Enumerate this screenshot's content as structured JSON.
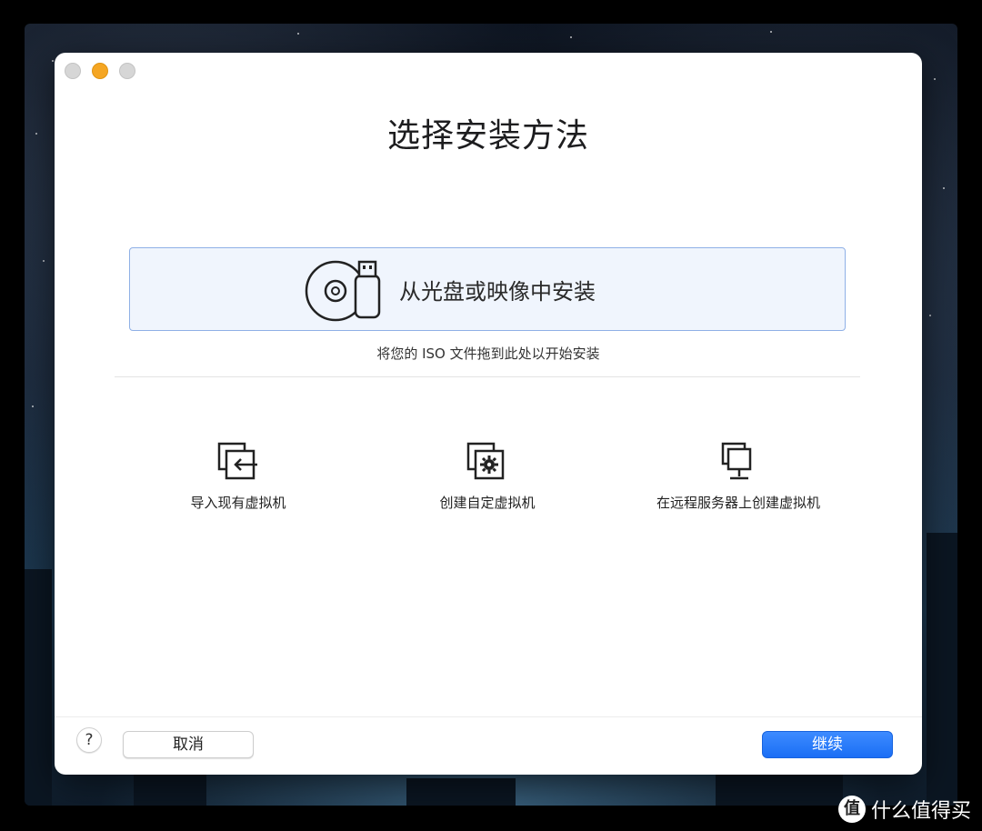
{
  "window": {
    "title": "选择安装方法"
  },
  "primary_option": {
    "label": "从光盘或映像中安装",
    "hint": "将您的 ISO 文件拖到此处以开始安装"
  },
  "options": [
    {
      "label": "导入现有虚拟机",
      "icon": "import-vm-icon"
    },
    {
      "label": "创建自定虚拟机",
      "icon": "custom-vm-icon"
    },
    {
      "label": "在远程服务器上创建虚拟机",
      "icon": "remote-server-icon"
    }
  ],
  "footer": {
    "help_label": "?",
    "cancel_label": "取消",
    "continue_label": "继续"
  },
  "watermark": {
    "badge": "值",
    "text": "什么值得买"
  },
  "colors": {
    "accent": "#1a6ef5",
    "traffic_minimize": "#f5a623",
    "drop_box_bg": "#f0f5fd",
    "drop_box_border": "#8fb0e6"
  }
}
